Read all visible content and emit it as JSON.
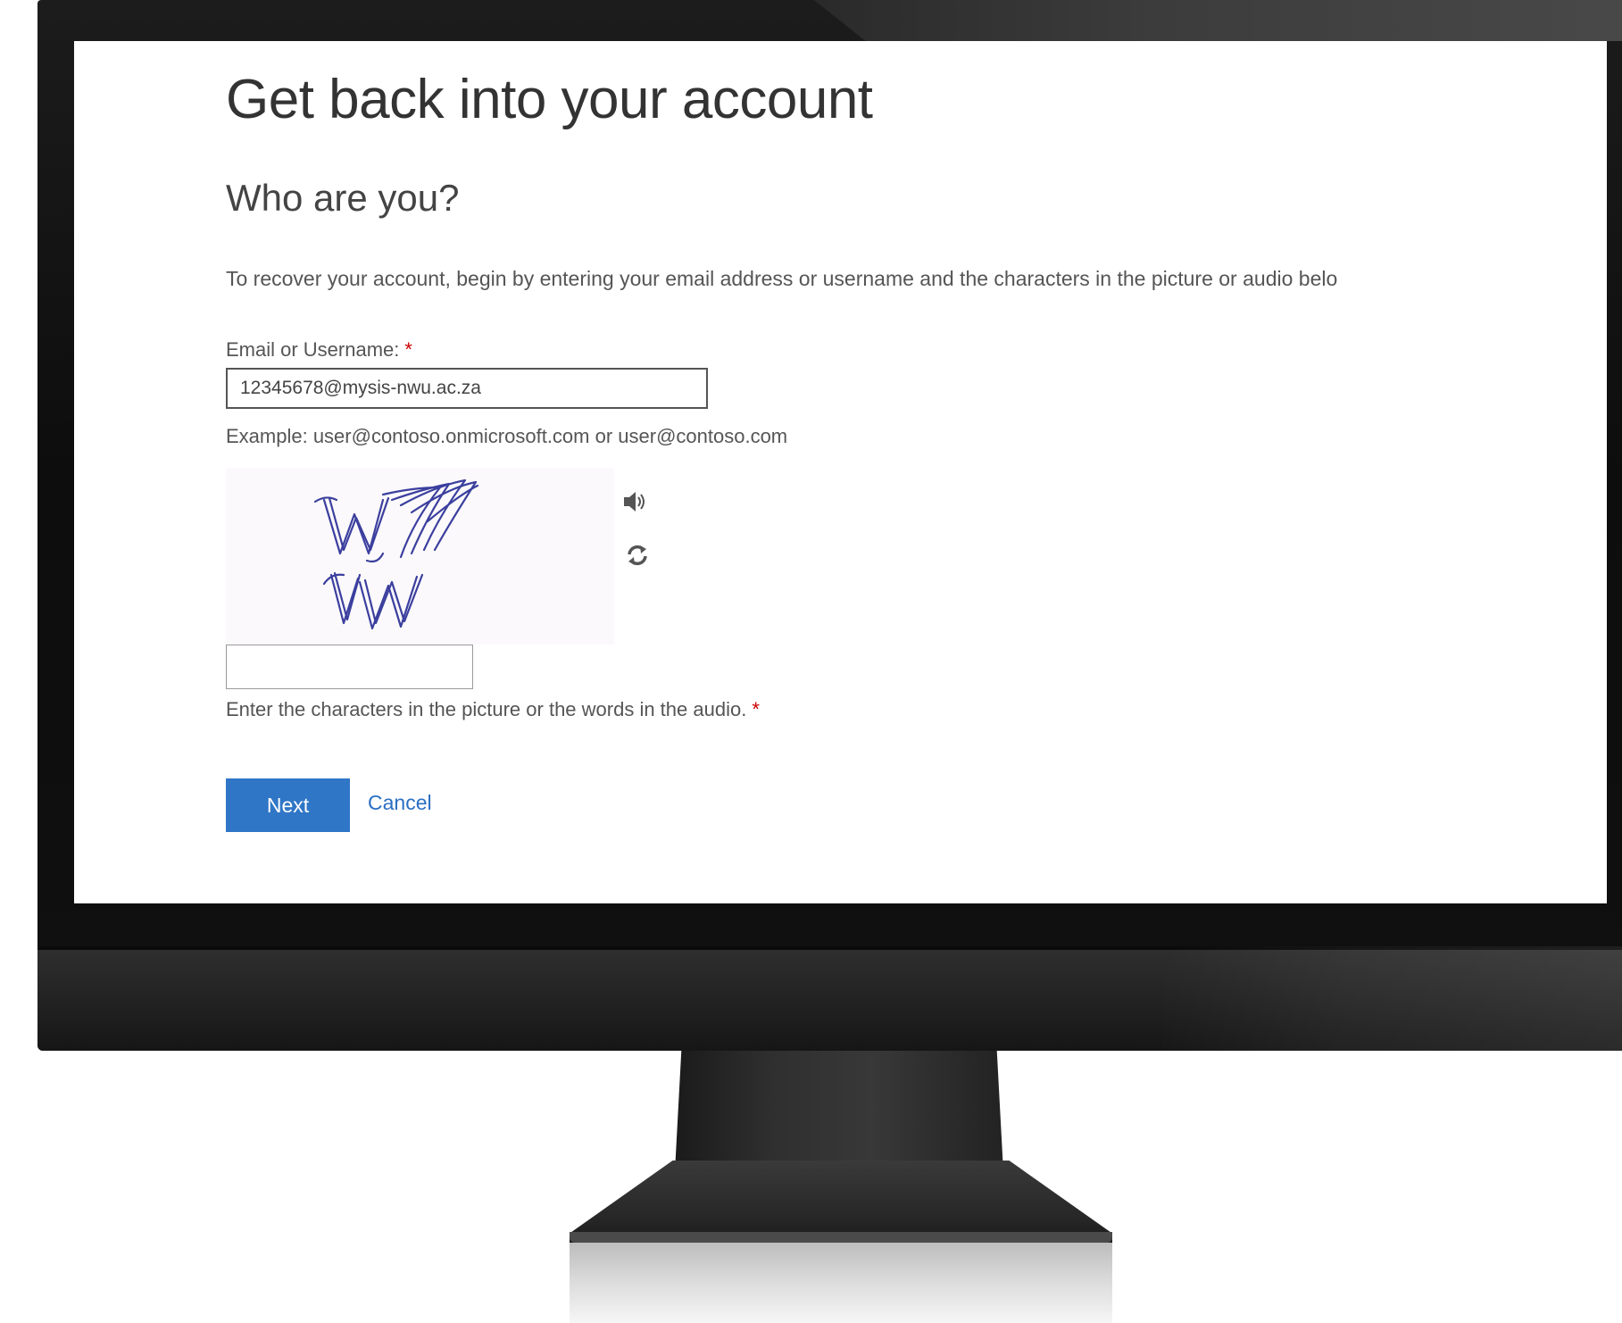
{
  "page": {
    "title": "Get back into your account",
    "section_title": "Who are you?",
    "instructions": "To recover your account, begin by entering your email address or username and the characters in the picture or audio belo"
  },
  "email_field": {
    "label": "Email or Username:",
    "required_mark": "*",
    "value": "12345678@mysis-nwu.ac.za",
    "example": "Example: user@contoso.onmicrosoft.com or user@contoso.com"
  },
  "captcha": {
    "image_text": "WJ7VW",
    "audio_icon": "speaker-icon",
    "refresh_icon": "refresh-icon",
    "input_value": "",
    "label": "Enter the characters in the picture or the words in the audio.",
    "required_mark": "*"
  },
  "actions": {
    "next_label": "Next",
    "cancel_label": "Cancel"
  },
  "colors": {
    "accent": "#2f76c7",
    "link": "#2a6fc3",
    "required": "#cc0000",
    "captcha_ink": "#3b3f9e"
  }
}
